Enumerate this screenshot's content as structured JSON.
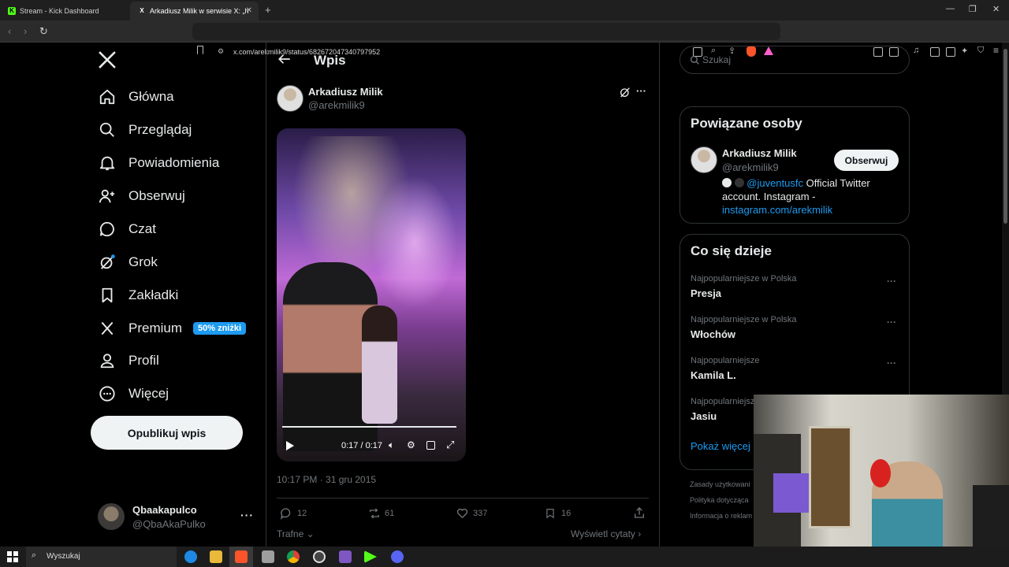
{
  "browser": {
    "tabs": [
      {
        "title": "Stream - Kick Dashboard"
      },
      {
        "title": "Arkadiusz Milik w serwisie X: „htt"
      }
    ],
    "url": "x.com/arekmilik9/status/682672047340797952"
  },
  "nav": {
    "items": [
      {
        "label": "Główna",
        "icon": "home-icon"
      },
      {
        "label": "Przeglądaj",
        "icon": "search-icon"
      },
      {
        "label": "Powiadomienia",
        "icon": "bell-icon"
      },
      {
        "label": "Obserwuj",
        "icon": "follow-icon"
      },
      {
        "label": "Czat",
        "icon": "chat-icon"
      },
      {
        "label": "Grok",
        "icon": "grok-icon"
      },
      {
        "label": "Zakładki",
        "icon": "bookmark-icon"
      },
      {
        "label": "Premium",
        "icon": "x-logo-icon",
        "badge": "50% zniżki"
      },
      {
        "label": "Profil",
        "icon": "person-icon"
      },
      {
        "label": "Więcej",
        "icon": "more-icon"
      }
    ],
    "post_button": "Opublikuj wpis",
    "account": {
      "name": "Qbaakapulco",
      "handle": "@QbaAkaPulko"
    }
  },
  "post": {
    "header_title": "Wpis",
    "author_name": "Arkadiusz Milik",
    "author_handle": "@arekmilik9",
    "video_time": "0:17 / 0:17",
    "video_progress": 1.0,
    "timestamp": "10:17 PM · 31 gru 2015",
    "replies": "12",
    "reposts": "61",
    "likes": "337",
    "bookmarks": "16",
    "sort_label": "Trafne",
    "quotes_label": "Wyświetl cytaty"
  },
  "sidebar": {
    "search_placeholder": "Szukaj",
    "related": {
      "title": "Powiązane osoby",
      "name": "Arkadiusz Milik",
      "handle": "@arekmilik9",
      "follow": "Obserwuj",
      "bio_mention": "@juventusfc",
      "bio_text": " Official Twitter account. Instagram -",
      "bio_link": "instagram.com/arekmilik"
    },
    "trends": {
      "title": "Co się dzieje",
      "items": [
        {
          "context": "Najpopularniejsze w Polska",
          "name": "Presja"
        },
        {
          "context": "Najpopularniejsze w Polska",
          "name": "Włochów"
        },
        {
          "context": "Najpopularniejsze",
          "name": "Kamila L."
        },
        {
          "context": "Najpopularniejsz",
          "name": "Jasiu"
        }
      ],
      "show_more": "Pokaż więcej"
    },
    "footer": [
      "Zasady użytkowani",
      "Polityka dotycząca",
      "Informacja o reklam"
    ]
  },
  "taskbar": {
    "search": "Wyszukaj"
  },
  "colors": {
    "accent": "#1d9bf0",
    "bg": "#000000",
    "border": "#2f3336",
    "muted": "#71767b"
  }
}
